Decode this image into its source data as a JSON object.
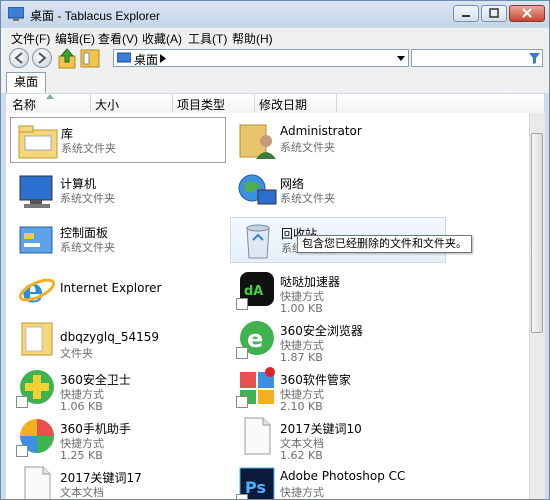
{
  "window": {
    "title": "桌面 - Tablacus Explorer"
  },
  "menu": [
    "文件(F)",
    "编辑(E)",
    "查看(V)",
    "收藏(A)",
    "工具(T)",
    "帮助(H)"
  ],
  "address": {
    "label": "桌面"
  },
  "tabs": [
    "桌面"
  ],
  "columns": [
    "名称",
    "大小",
    "项目类型",
    "修改日期"
  ],
  "items": [
    {
      "name": "库",
      "sub1": "系统文件夹",
      "sub2": "",
      "icon": "library-folder-icon"
    },
    {
      "name": "Administrator",
      "sub1": "系统文件夹",
      "sub2": "",
      "icon": "user-folder-icon"
    },
    {
      "name": "计算机",
      "sub1": "系统文件夹",
      "sub2": "",
      "icon": "computer-icon"
    },
    {
      "name": "网络",
      "sub1": "系统文件夹",
      "sub2": "",
      "icon": "network-icon"
    },
    {
      "name": "控制面板",
      "sub1": "系统文件夹",
      "sub2": "",
      "icon": "control-panel-icon"
    },
    {
      "name": "回收站",
      "sub1": "系统文件夹",
      "sub2": "",
      "icon": "recycle-bin-icon"
    },
    {
      "name": "Internet Explorer",
      "sub1": "",
      "sub2": "",
      "icon": "internet-explorer-icon"
    },
    {
      "name": "哒哒加速器",
      "sub1": "快捷方式",
      "sub2": "1.00 KB",
      "icon": "dada-accelerator-icon"
    },
    {
      "name": "dbqzyglq_54159",
      "sub1": "文件夹",
      "sub2": "",
      "icon": "folder-icon"
    },
    {
      "name": "360安全浏览器",
      "sub1": "快捷方式",
      "sub2": "1.87 KB",
      "icon": "360-browser-icon"
    },
    {
      "name": "360安全卫士",
      "sub1": "快捷方式",
      "sub2": "1.06 KB",
      "icon": "360-safe-icon"
    },
    {
      "name": "360软件管家",
      "sub1": "快捷方式",
      "sub2": "2.10 KB",
      "icon": "360-software-manager-icon"
    },
    {
      "name": "360手机助手",
      "sub1": "快捷方式",
      "sub2": "1.25 KB",
      "icon": "360-mobile-assistant-icon"
    },
    {
      "name": "2017关键词10",
      "sub1": "文本文档",
      "sub2": "1.62 KB",
      "icon": "text-document-icon"
    },
    {
      "name": "2017关键词17",
      "sub1": "文本文档",
      "sub2": "",
      "icon": "text-document-icon"
    },
    {
      "name": "Adobe Photoshop CC",
      "sub1": "快捷方式",
      "sub2": "",
      "icon": "photoshop-icon"
    }
  ],
  "tooltip": "包含您已经删除的文件和文件夹。",
  "colors": {
    "title_bg": "#cfdcec",
    "selection_border": "#a0a0a0",
    "hover_bg": "#e6f0fa"
  }
}
